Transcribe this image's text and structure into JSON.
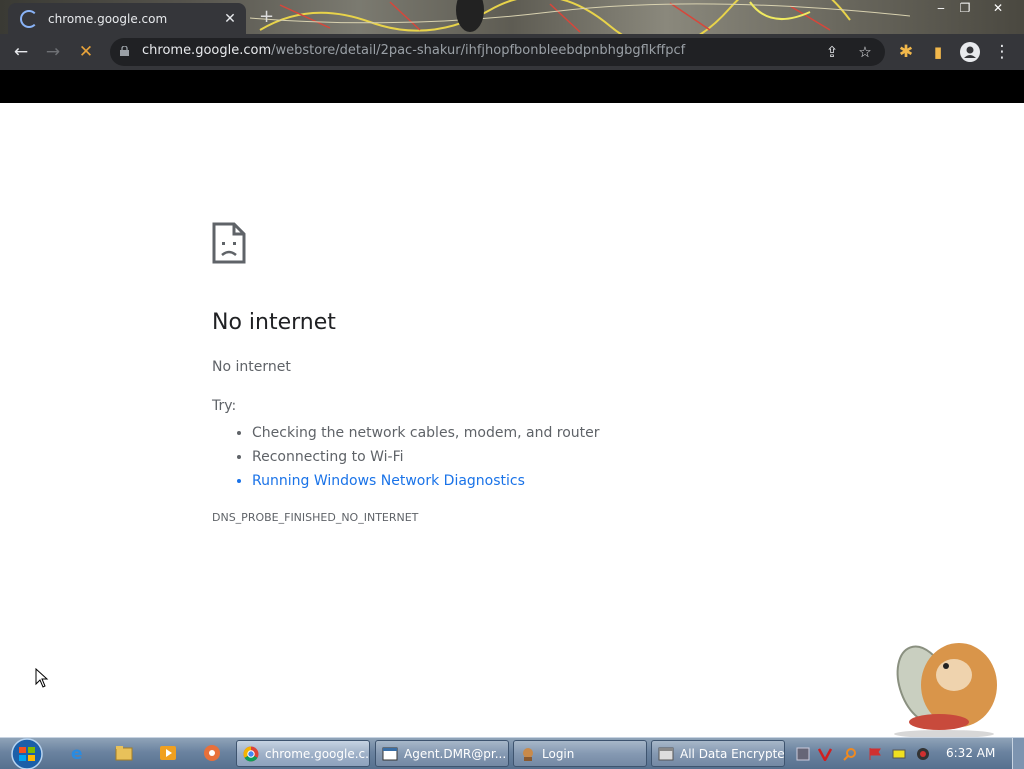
{
  "tab": {
    "title": "chrome.google.com"
  },
  "omnibox": {
    "host": "chrome.google.com",
    "path": "/webstore/detail/2pac-shakur/ihfjhopfbonbleebdpnbhgbgflkffpcf"
  },
  "error": {
    "title": "No internet",
    "subtitle": "No internet",
    "try_label": "Try:",
    "suggestions": [
      "Checking the network cables, modem, and router",
      "Reconnecting to Wi-Fi",
      "Running Windows Network Diagnostics"
    ],
    "code": "DNS_PROBE_FINISHED_NO_INTERNET"
  },
  "taskbar": {
    "tasks": [
      {
        "label": "chrome.google.c..."
      },
      {
        "label": "Agent.DMR@pr..."
      },
      {
        "label": "Login"
      },
      {
        "label": "All Data Encrypted"
      }
    ],
    "clock": "6:32 AM"
  },
  "colors": {
    "link": "#1a73e8",
    "toolbar": "#35363a",
    "omnibox": "#202124"
  },
  "icons": [
    "spinner-icon",
    "close-icon",
    "back-icon",
    "forward-icon",
    "stop-icon",
    "lock-icon",
    "share-icon",
    "star-icon",
    "extensions-icon",
    "sidepanel-icon",
    "profile-icon",
    "menu-icon",
    "sad-page-icon"
  ]
}
